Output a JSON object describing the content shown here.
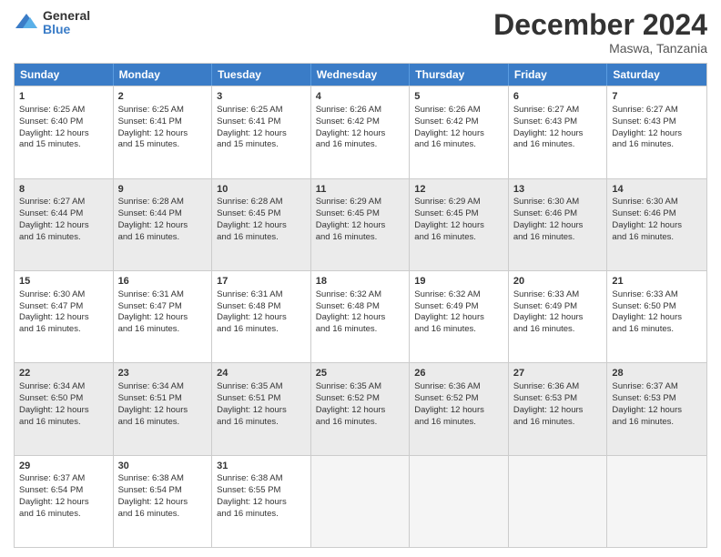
{
  "logo": {
    "general": "General",
    "blue": "Blue"
  },
  "title": "December 2024",
  "location": "Maswa, Tanzania",
  "days_of_week": [
    "Sunday",
    "Monday",
    "Tuesday",
    "Wednesday",
    "Thursday",
    "Friday",
    "Saturday"
  ],
  "weeks": [
    [
      {
        "day": 1,
        "sunrise": "6:25 AM",
        "sunset": "6:40 PM",
        "daylight": "12 hours and 15 minutes."
      },
      {
        "day": 2,
        "sunrise": "6:25 AM",
        "sunset": "6:41 PM",
        "daylight": "12 hours and 15 minutes."
      },
      {
        "day": 3,
        "sunrise": "6:25 AM",
        "sunset": "6:41 PM",
        "daylight": "12 hours and 15 minutes."
      },
      {
        "day": 4,
        "sunrise": "6:26 AM",
        "sunset": "6:42 PM",
        "daylight": "12 hours and 16 minutes."
      },
      {
        "day": 5,
        "sunrise": "6:26 AM",
        "sunset": "6:42 PM",
        "daylight": "12 hours and 16 minutes."
      },
      {
        "day": 6,
        "sunrise": "6:27 AM",
        "sunset": "6:43 PM",
        "daylight": "12 hours and 16 minutes."
      },
      {
        "day": 7,
        "sunrise": "6:27 AM",
        "sunset": "6:43 PM",
        "daylight": "12 hours and 16 minutes."
      }
    ],
    [
      {
        "day": 8,
        "sunrise": "6:27 AM",
        "sunset": "6:44 PM",
        "daylight": "12 hours and 16 minutes."
      },
      {
        "day": 9,
        "sunrise": "6:28 AM",
        "sunset": "6:44 PM",
        "daylight": "12 hours and 16 minutes."
      },
      {
        "day": 10,
        "sunrise": "6:28 AM",
        "sunset": "6:45 PM",
        "daylight": "12 hours and 16 minutes."
      },
      {
        "day": 11,
        "sunrise": "6:29 AM",
        "sunset": "6:45 PM",
        "daylight": "12 hours and 16 minutes."
      },
      {
        "day": 12,
        "sunrise": "6:29 AM",
        "sunset": "6:45 PM",
        "daylight": "12 hours and 16 minutes."
      },
      {
        "day": 13,
        "sunrise": "6:30 AM",
        "sunset": "6:46 PM",
        "daylight": "12 hours and 16 minutes."
      },
      {
        "day": 14,
        "sunrise": "6:30 AM",
        "sunset": "6:46 PM",
        "daylight": "12 hours and 16 minutes."
      }
    ],
    [
      {
        "day": 15,
        "sunrise": "6:30 AM",
        "sunset": "6:47 PM",
        "daylight": "12 hours and 16 minutes."
      },
      {
        "day": 16,
        "sunrise": "6:31 AM",
        "sunset": "6:47 PM",
        "daylight": "12 hours and 16 minutes."
      },
      {
        "day": 17,
        "sunrise": "6:31 AM",
        "sunset": "6:48 PM",
        "daylight": "12 hours and 16 minutes."
      },
      {
        "day": 18,
        "sunrise": "6:32 AM",
        "sunset": "6:48 PM",
        "daylight": "12 hours and 16 minutes."
      },
      {
        "day": 19,
        "sunrise": "6:32 AM",
        "sunset": "6:49 PM",
        "daylight": "12 hours and 16 minutes."
      },
      {
        "day": 20,
        "sunrise": "6:33 AM",
        "sunset": "6:49 PM",
        "daylight": "12 hours and 16 minutes."
      },
      {
        "day": 21,
        "sunrise": "6:33 AM",
        "sunset": "6:50 PM",
        "daylight": "12 hours and 16 minutes."
      }
    ],
    [
      {
        "day": 22,
        "sunrise": "6:34 AM",
        "sunset": "6:50 PM",
        "daylight": "12 hours and 16 minutes."
      },
      {
        "day": 23,
        "sunrise": "6:34 AM",
        "sunset": "6:51 PM",
        "daylight": "12 hours and 16 minutes."
      },
      {
        "day": 24,
        "sunrise": "6:35 AM",
        "sunset": "6:51 PM",
        "daylight": "12 hours and 16 minutes."
      },
      {
        "day": 25,
        "sunrise": "6:35 AM",
        "sunset": "6:52 PM",
        "daylight": "12 hours and 16 minutes."
      },
      {
        "day": 26,
        "sunrise": "6:36 AM",
        "sunset": "6:52 PM",
        "daylight": "12 hours and 16 minutes."
      },
      {
        "day": 27,
        "sunrise": "6:36 AM",
        "sunset": "6:53 PM",
        "daylight": "12 hours and 16 minutes."
      },
      {
        "day": 28,
        "sunrise": "6:37 AM",
        "sunset": "6:53 PM",
        "daylight": "12 hours and 16 minutes."
      }
    ],
    [
      {
        "day": 29,
        "sunrise": "6:37 AM",
        "sunset": "6:54 PM",
        "daylight": "12 hours and 16 minutes."
      },
      {
        "day": 30,
        "sunrise": "6:38 AM",
        "sunset": "6:54 PM",
        "daylight": "12 hours and 16 minutes."
      },
      {
        "day": 31,
        "sunrise": "6:38 AM",
        "sunset": "6:55 PM",
        "daylight": "12 hours and 16 minutes."
      },
      null,
      null,
      null,
      null
    ]
  ],
  "labels": {
    "sunrise": "Sunrise:",
    "sunset": "Sunset:",
    "daylight": "Daylight:"
  }
}
